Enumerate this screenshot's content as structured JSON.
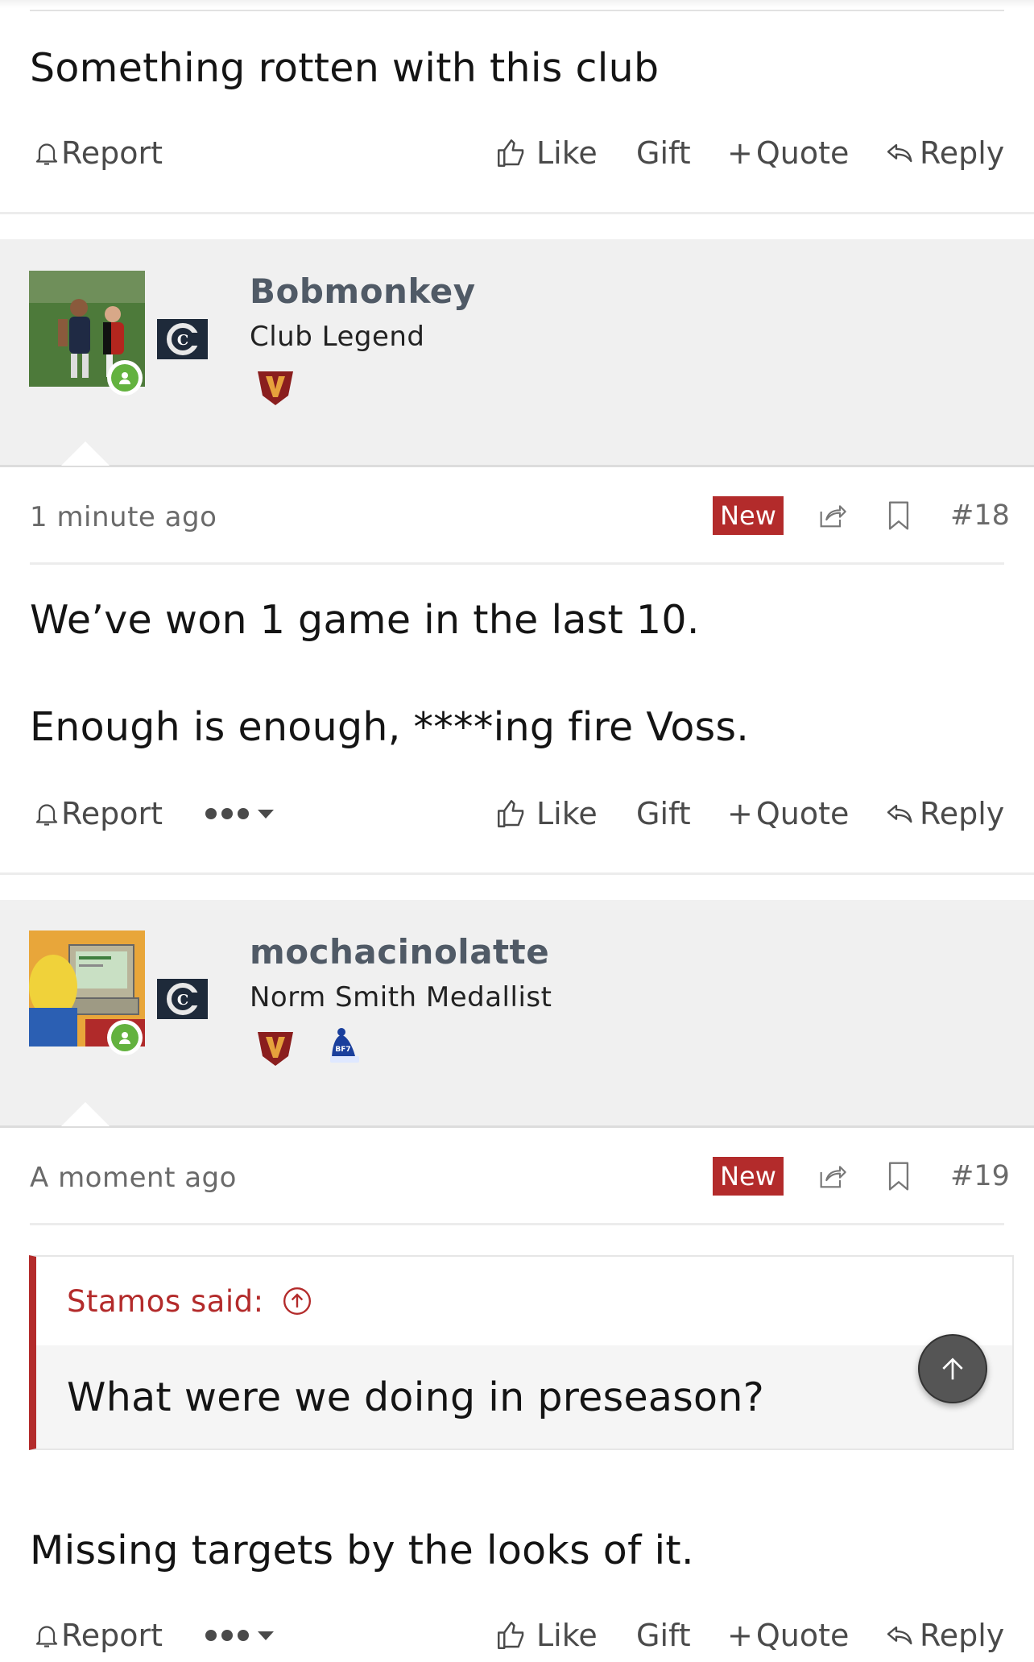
{
  "actions": {
    "report": "Report",
    "like": "Like",
    "gift": "Gift",
    "quote": "Quote",
    "reply": "Reply"
  },
  "prev_post": {
    "message": "Something rotten with this club"
  },
  "posts": [
    {
      "username": "Bobmonkey",
      "user_title": "Club Legend",
      "time": "1 minute ago",
      "badge": "New",
      "post_number": "#18",
      "lines": [
        "We’ve won 1 game in the last 10.",
        "Enough is enough, ****ing fire Voss."
      ],
      "avatar_icon": "football-players-avatar",
      "club_icon": "carlton-club-logo"
    },
    {
      "username": "mochacinolatte",
      "user_title": "Norm Smith Medallist",
      "time": "A moment ago",
      "badge": "New",
      "post_number": "#19",
      "quote": {
        "author_label": "Stamos said:",
        "text": "What were we doing in preseason?"
      },
      "lines": [
        "Missing targets by the looks of it."
      ],
      "avatar_icon": "cartoon-computer-avatar",
      "club_icon": "carlton-club-logo",
      "extra_badge": "BF7"
    }
  ],
  "colors": {
    "accent": "#b32b2b",
    "online": "#63b23f",
    "username": "#505a66",
    "user_panel": "#f0f0f0"
  }
}
